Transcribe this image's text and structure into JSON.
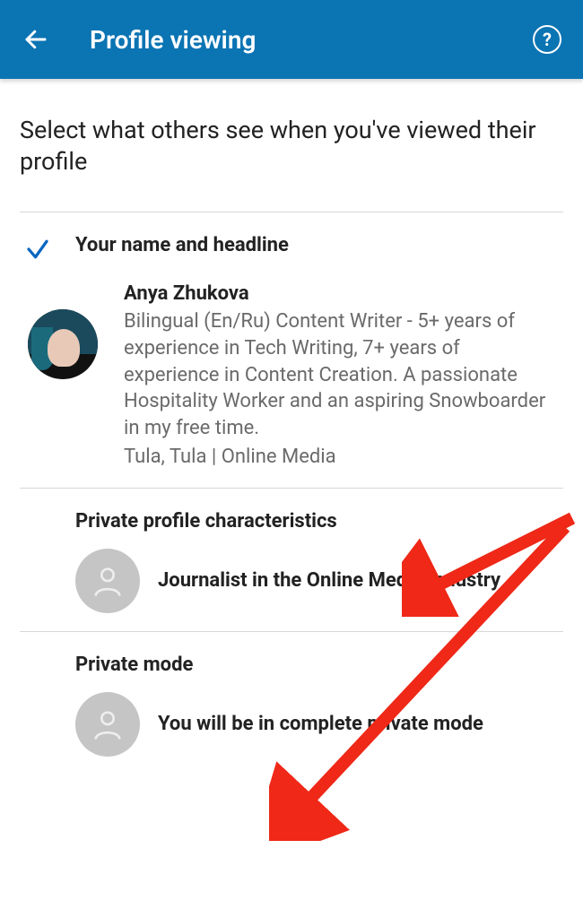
{
  "header": {
    "title": "Profile viewing"
  },
  "intro": "Select what others see when you've viewed their profile",
  "options": [
    {
      "title": "Your name and headline",
      "selected": true,
      "name": "Anya Zhukova",
      "description": "Bilingual (En/Ru) Content Writer - 5+ years of experience in Tech Writing, 7+ years of experience in Content Creation. A passionate Hospitality Worker and an aspiring Snowboarder in my free time.",
      "location": "Tula, Tula | Online Media"
    },
    {
      "title": "Private profile characteristics",
      "subtitle": "Journalist in the Online Media industry"
    },
    {
      "title": "Private mode",
      "subtitle": "You will be in complete private mode"
    }
  ],
  "colors": {
    "header_bg": "#0b74b3",
    "accent_blue": "#0a66c2",
    "annotation": "#ef2817"
  }
}
